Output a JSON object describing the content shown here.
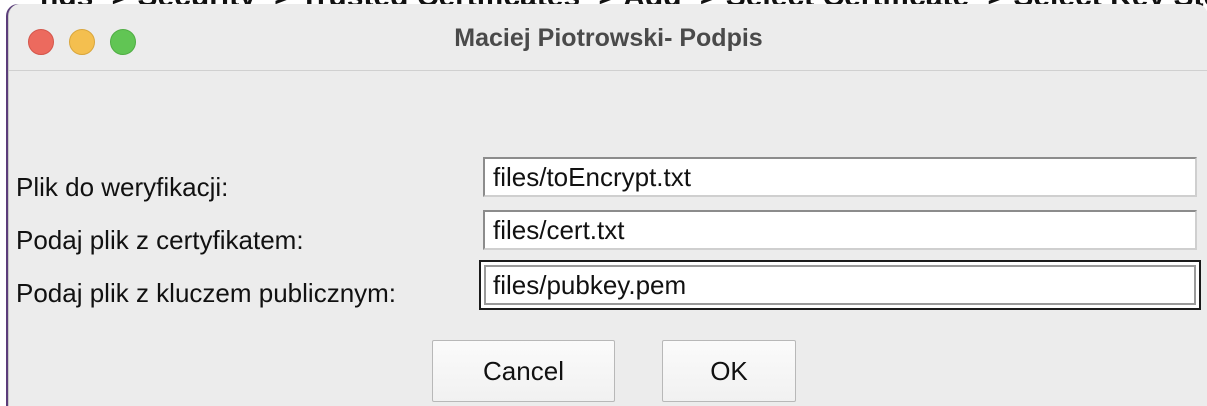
{
  "background_text": "ngs -> Security -> Trusted Certificates -> Add -> Select Certificate -> Select Key Store -> Trusted Root",
  "window": {
    "title": "Maciej Piotrowski- Podpis"
  },
  "form": {
    "fields": [
      {
        "label": "Plik do weryfikacji:",
        "value": "files/toEncrypt.txt"
      },
      {
        "label": "Podaj plik z certyfikatem:",
        "value": "files/cert.txt"
      },
      {
        "label": "Podaj plik z kluczem publicznym:",
        "value": "files/pubkey.pem"
      }
    ]
  },
  "buttons": {
    "cancel_label": "Cancel",
    "ok_label": "OK"
  },
  "colors": {
    "close": "#ec6a5e",
    "minimize": "#f4bf4f",
    "maximize": "#61c554",
    "window_bg": "#ececec"
  }
}
